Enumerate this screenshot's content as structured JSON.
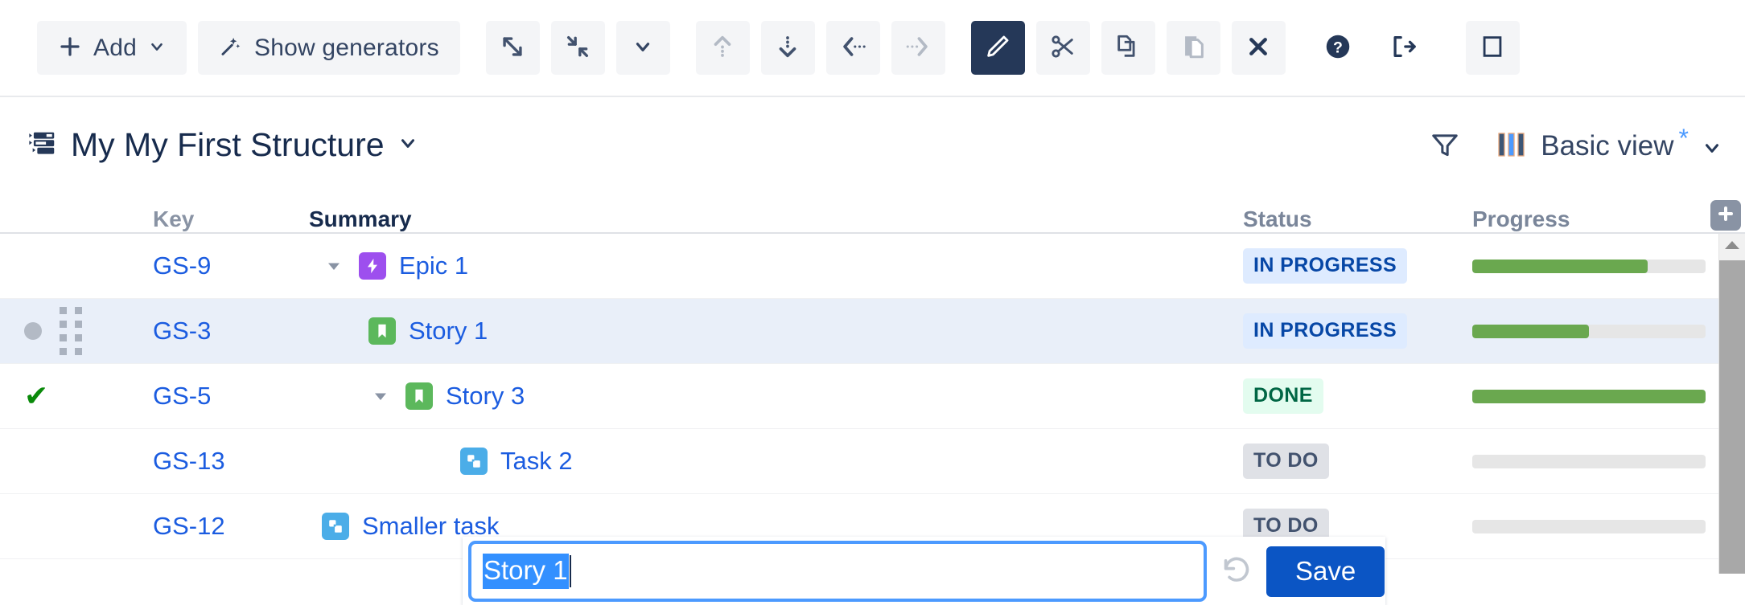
{
  "toolbar": {
    "add_label": "Add",
    "add_icon": "plus-icon",
    "add_caret_icon": "chevron-down-icon",
    "generators_label": "Show generators",
    "generators_icon": "magic-wand-icon",
    "buttons": [
      {
        "name": "expand-all-button",
        "icon": "expand-diagonal-icon",
        "state": "enabled"
      },
      {
        "name": "collapse-all-button",
        "icon": "collapse-diagonal-icon",
        "state": "enabled"
      },
      {
        "name": "expand-level-dropdown-button",
        "icon": "chevron-down-icon",
        "state": "enabled"
      },
      {
        "name": "move-up-button",
        "icon": "arrow-up-dotted-icon",
        "state": "disabled"
      },
      {
        "name": "move-down-button",
        "icon": "arrow-down-dotted-icon",
        "state": "enabled"
      },
      {
        "name": "outdent-button",
        "icon": "arrow-left-dotted-icon",
        "state": "enabled"
      },
      {
        "name": "indent-button",
        "icon": "arrow-right-dotted-icon",
        "state": "disabled"
      },
      {
        "name": "edit-button",
        "icon": "pencil-icon",
        "state": "active"
      },
      {
        "name": "cut-button",
        "icon": "scissors-icon",
        "state": "enabled"
      },
      {
        "name": "copy-button",
        "icon": "copy-pages-icon",
        "state": "enabled"
      },
      {
        "name": "paste-button",
        "icon": "paste-icon",
        "state": "disabled"
      },
      {
        "name": "delete-button",
        "icon": "x-icon",
        "state": "enabled"
      },
      {
        "name": "help-button",
        "icon": "question-circle-icon",
        "state": "enabled"
      },
      {
        "name": "exit-button",
        "icon": "exit-arrow-icon",
        "state": "enabled"
      },
      {
        "name": "fullscreen-button",
        "icon": "square-outline-icon",
        "state": "enabled"
      }
    ]
  },
  "structure": {
    "icon": "structure-list-icon",
    "title": "My My First Structure",
    "title_caret_icon": "chevron-down-icon",
    "filter_icon": "funnel-icon",
    "view_icon": "columns-icon",
    "view_name": "Basic view",
    "view_modified_marker": "*",
    "view_caret_icon": "chevron-down-icon"
  },
  "table": {
    "columns": [
      {
        "key": "key",
        "label": "Key"
      },
      {
        "key": "summary",
        "label": "Summary"
      },
      {
        "key": "status",
        "label": "Status"
      },
      {
        "key": "progress",
        "label": "Progress"
      }
    ],
    "add_column_icon": "plus-icon",
    "rows": [
      {
        "marker": "none",
        "key": "GS-9",
        "indent": 0,
        "disclosure": "expanded",
        "issue_type": "epic",
        "issue_icon": "epic-bolt-icon",
        "summary": "Epic 1",
        "status": "IN PROGRESS",
        "status_variant": "inprogress",
        "progress": 75,
        "selected": false
      },
      {
        "marker": "dot",
        "drag_handle": "drag-dots-icon",
        "key": "GS-3",
        "indent": 1,
        "disclosure": "none",
        "issue_type": "story",
        "issue_icon": "story-bookmark-icon",
        "summary": "Story 1",
        "status": "IN PROGRESS",
        "status_variant": "inprogress",
        "progress": 50,
        "selected": true,
        "editing": true
      },
      {
        "marker": "check",
        "key": "GS-5",
        "indent": 1,
        "disclosure": "expanded",
        "issue_type": "story",
        "issue_icon": "story-bookmark-icon",
        "summary": "Story 3",
        "status": "DONE",
        "status_variant": "done",
        "progress": 100,
        "selected": false
      },
      {
        "marker": "none",
        "key": "GS-13",
        "indent": 2,
        "disclosure": "none",
        "issue_type": "task",
        "issue_icon": "task-squares-icon",
        "summary": "Task 2",
        "status": "TO DO",
        "status_variant": "todo",
        "progress": 0,
        "selected": false
      },
      {
        "marker": "none",
        "key": "GS-12",
        "indent": 0,
        "disclosure": "none",
        "issue_type": "task",
        "issue_icon": "task-squares-icon",
        "summary": "Smaller task",
        "status": "TO DO",
        "status_variant": "todo",
        "progress": 0,
        "selected": false
      }
    ]
  },
  "edit_overlay": {
    "input_value": "Story 1",
    "input_selected": true,
    "revert_icon": "revert-circular-arrow-icon",
    "save_label": "Save"
  },
  "scrollbar": {
    "up_arrow_icon": "triangle-up-icon"
  },
  "colors": {
    "link": "#1b5ce0",
    "accent_blue": "#4c9aff",
    "save_blue": "#0b55c4",
    "progress_green": "#6aa84f",
    "epic_purple": "#9d4fee",
    "story_green": "#5cb85c",
    "task_blue": "#4bade8",
    "active_toolbar": "#253858",
    "text_dark": "#172b4d"
  }
}
